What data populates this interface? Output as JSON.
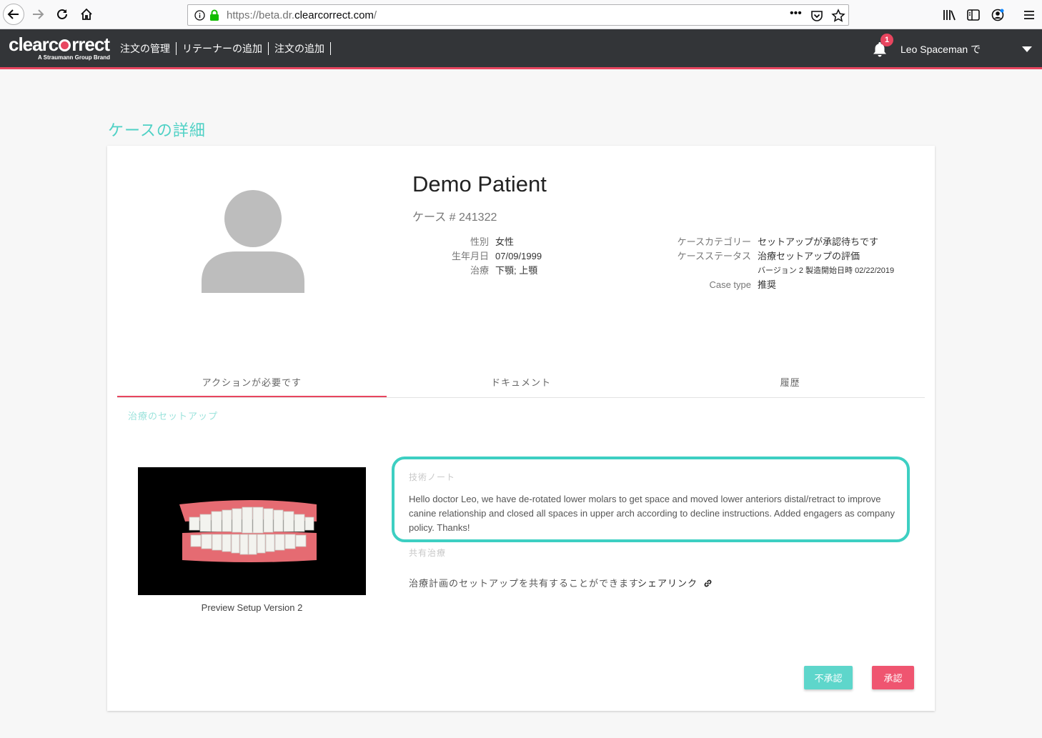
{
  "browser": {
    "url_prefix": "https://beta.dr.",
    "url_domain": "clearcorrect.com",
    "url_suffix": "/"
  },
  "header": {
    "logo_text_1": "clearc",
    "logo_text_2": "rrect",
    "logo_sub": "A Straumann Group Brand",
    "nav": [
      "注文の管理",
      "リテーナーの追加",
      "注文の追加"
    ],
    "notification_count": "1",
    "user": "Leo Spaceman で"
  },
  "page": {
    "title": "ケースの詳細"
  },
  "patient": {
    "name": "Demo Patient",
    "case_number": "ケース # 241322",
    "left_info": [
      {
        "label": "性別",
        "value": "女性"
      },
      {
        "label": "生年月日",
        "value": "07/09/1999"
      },
      {
        "label": "治療",
        "value": "下顎; 上顎"
      }
    ],
    "right_info": {
      "category_label": "ケースカテゴリー",
      "category_value": "セットアップが承認待ちです",
      "status_label": "ケースステータス",
      "status_value": "治療セットアップの評価",
      "version_value": "バージョン 2 製造開始日時 02/22/2019",
      "type_label": "Case type",
      "type_value": "推奨"
    }
  },
  "tabs": [
    "アクションが必要です",
    "ドキュメント",
    "履歴"
  ],
  "section": {
    "title": "治療のセットアップ",
    "preview_caption": "Preview Setup Version 2",
    "notes_label": "技術ノート",
    "notes_text": "Hello doctor Leo, we have de-rotated lower molars to get space and moved lower anteriors distal/retract to improve canine relationship and closed all spaces in upper arch according to decline instructions. Added engagers as company policy. Thanks!",
    "share_label": "共有治療",
    "share_text": "治療計画のセットアップを共有することができます",
    "share_link": "シェアリンク"
  },
  "buttons": {
    "reject": "不承認",
    "approve": "承認"
  },
  "colors": {
    "accent_teal": "#3dcfc2",
    "accent_red": "#e8455f",
    "header_bg": "#333538"
  }
}
